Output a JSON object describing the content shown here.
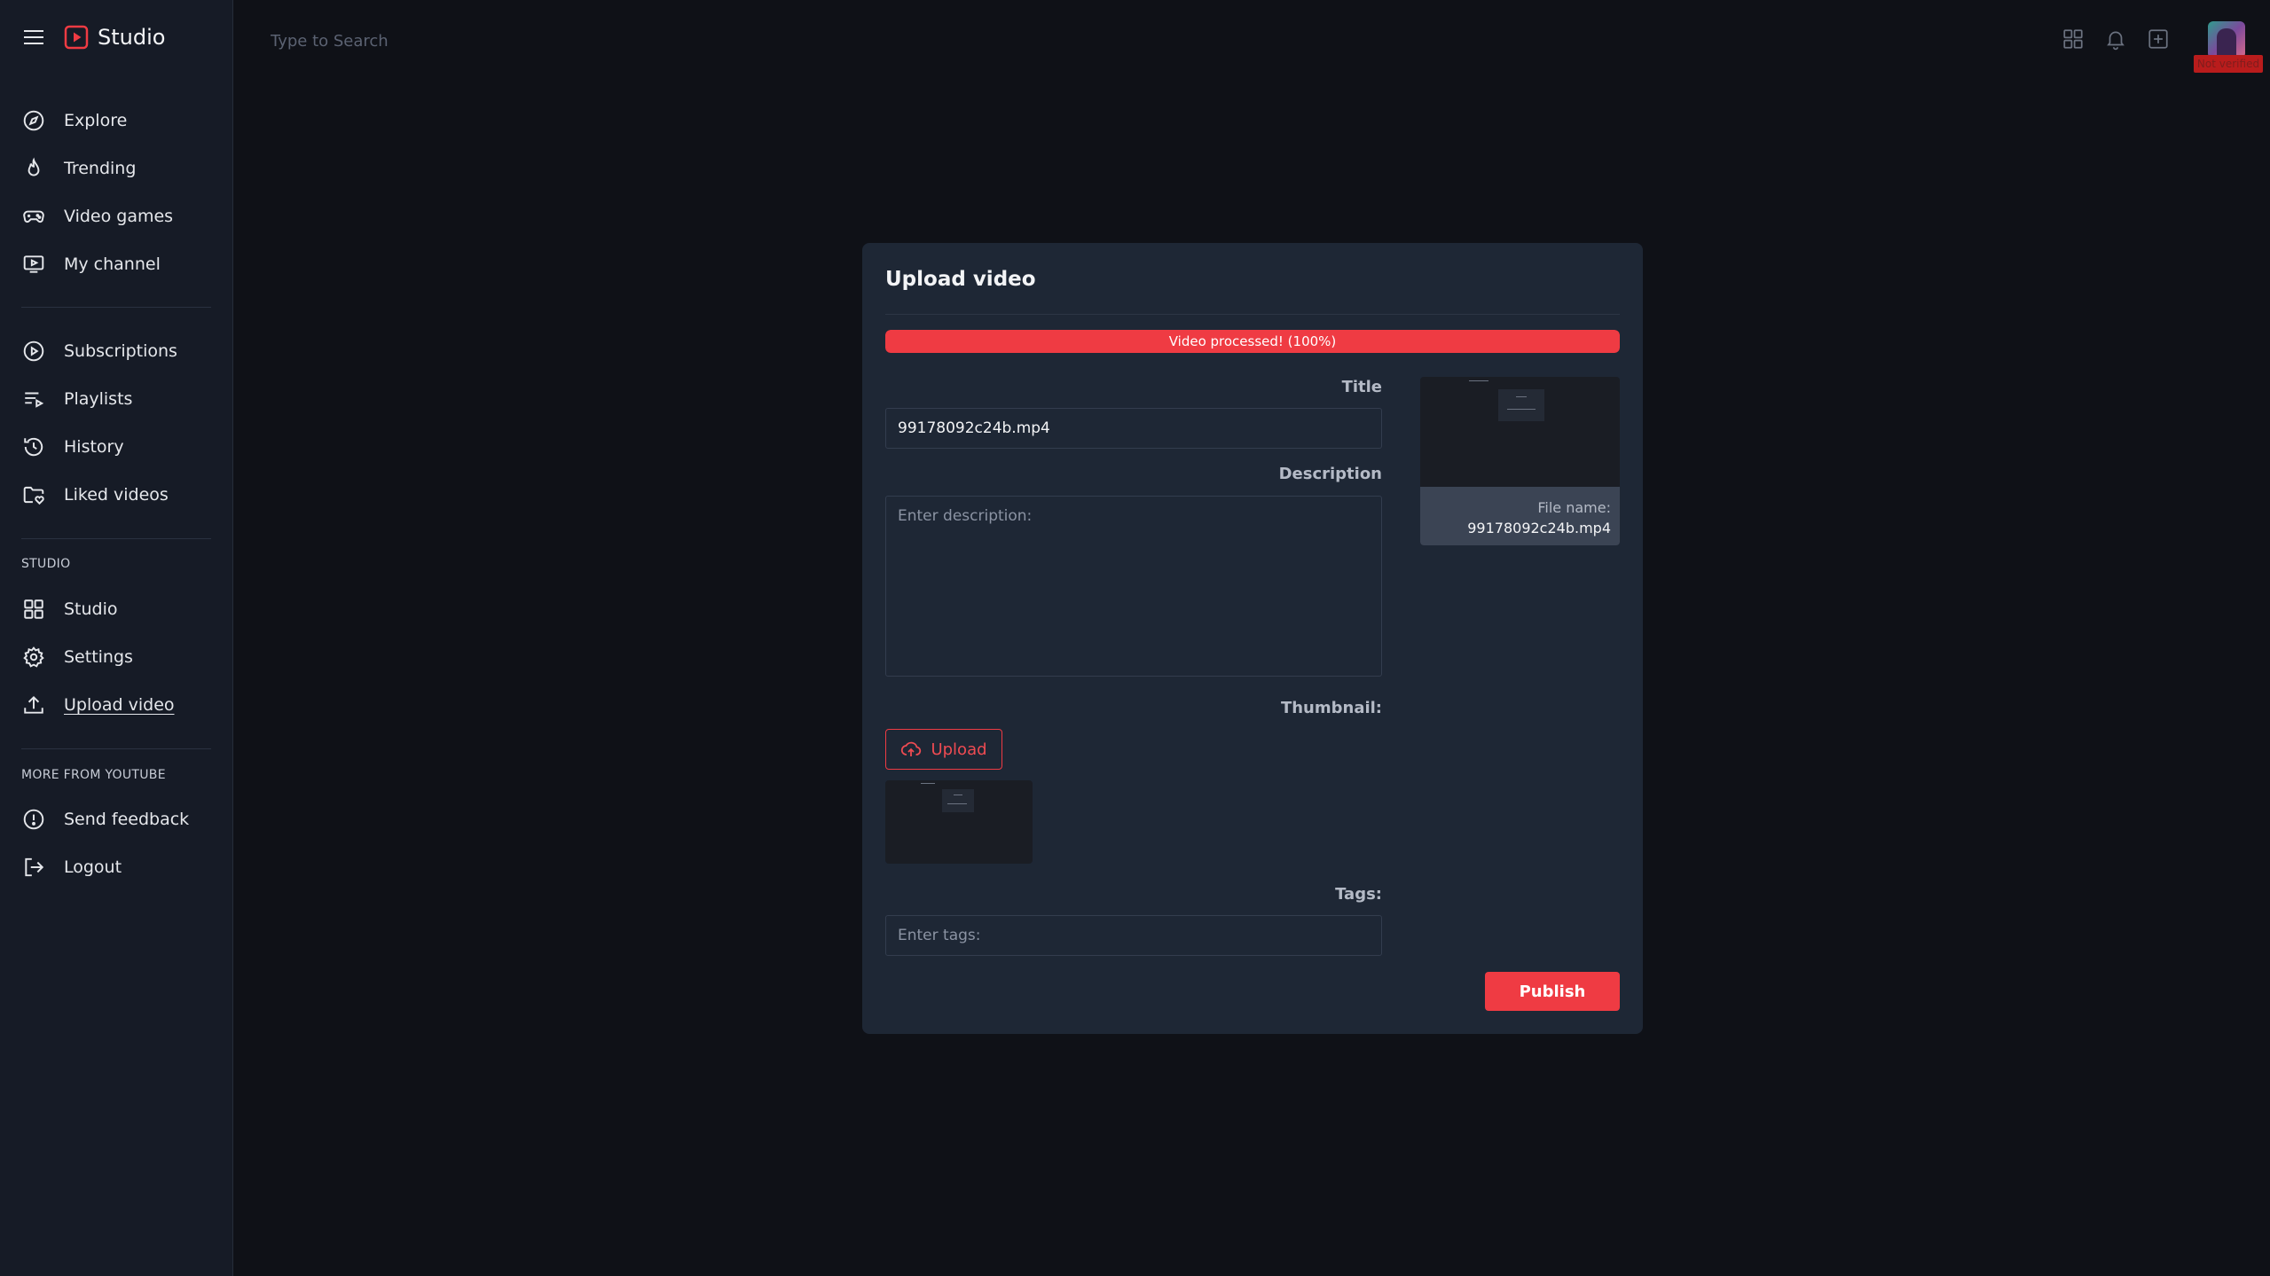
{
  "app": {
    "brand": "Studio",
    "brand_color": "#ef3b43"
  },
  "sidebar": {
    "main": [
      {
        "label": "Explore",
        "icon": "compass-icon"
      },
      {
        "label": "Trending",
        "icon": "flame-icon"
      },
      {
        "label": "Video games",
        "icon": "gamepad-icon"
      },
      {
        "label": "My channel",
        "icon": "channel-icon"
      }
    ],
    "library": [
      {
        "label": "Subscriptions",
        "icon": "play-circle-icon"
      },
      {
        "label": "Playlists",
        "icon": "playlist-icon"
      },
      {
        "label": "History",
        "icon": "history-icon"
      },
      {
        "label": "Liked videos",
        "icon": "liked-folder-icon"
      }
    ],
    "studio_heading": "STUDIO",
    "studio": [
      {
        "label": "Studio",
        "icon": "grid-icon"
      },
      {
        "label": "Settings",
        "icon": "gear-icon"
      },
      {
        "label": "Upload video",
        "icon": "upload-icon",
        "active": true
      }
    ],
    "more_heading": "MORE FROM YOUTUBE",
    "more": [
      {
        "label": "Send feedback",
        "icon": "alert-circle-icon"
      },
      {
        "label": "Logout",
        "icon": "logout-icon"
      }
    ]
  },
  "topbar": {
    "search_placeholder": "Type to Search",
    "badge": "Not verified"
  },
  "modal": {
    "title": "Upload video",
    "progress": {
      "text": "Video processed! (100%)",
      "percent": 100
    },
    "title_label": "Title",
    "title_value": "99178092c24b.mp4",
    "description_label": "Description",
    "description_placeholder": "Enter description:",
    "thumbnail_label": "Thumbnail:",
    "upload_label": "Upload",
    "tags_label": "Tags:",
    "tags_placeholder": "Enter tags:",
    "preview": {
      "file_label": "File name:",
      "file_name": "99178092c24b.mp4"
    },
    "publish_label": "Publish"
  }
}
